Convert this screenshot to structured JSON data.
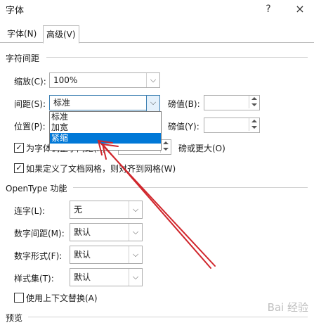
{
  "window": {
    "title": "字体",
    "help_glyph": "?",
    "close_glyph": "×"
  },
  "tabs": [
    {
      "label": "字体(N)",
      "active": false
    },
    {
      "label": "高级(V)",
      "active": true
    }
  ],
  "sections": {
    "char_spacing": "字符间距",
    "opentype": "OpenType 功能",
    "preview": "预览"
  },
  "char_spacing": {
    "scale": {
      "label": "缩放(C):",
      "value": "100%"
    },
    "spacing": {
      "label": "间距(S):",
      "value": "标准",
      "pt_label": "磅值(B):",
      "pt_value": ""
    },
    "position": {
      "label": "位置(P):",
      "pt_label": "磅值(Y):",
      "pt_value": ""
    },
    "dropdown_options": [
      "标准",
      "加宽",
      "紧缩"
    ],
    "dropdown_selected_index": 2,
    "kerning": {
      "label": "为字体调整字间距(K):",
      "checked": true,
      "suffix": "磅或更大(O)"
    },
    "grid": {
      "label": "如果定义了文档网格，则对齐到网格(W)",
      "checked": true
    }
  },
  "opentype": {
    "ligatures": {
      "label": "连字(L):",
      "value": "无"
    },
    "num_spacing": {
      "label": "数字间距(M):",
      "value": "默认"
    },
    "num_forms": {
      "label": "数字形式(F):",
      "value": "默认"
    },
    "style_sets": {
      "label": "样式集(T):",
      "value": "默认"
    },
    "contextual": {
      "label": "使用上下文替换(A)",
      "checked": false
    }
  },
  "watermark": "Bai 经验",
  "icons": {
    "check": "✓",
    "chevron": "⌵"
  },
  "colors": {
    "selection": "#0078d7",
    "annotation": "#d0262c"
  }
}
